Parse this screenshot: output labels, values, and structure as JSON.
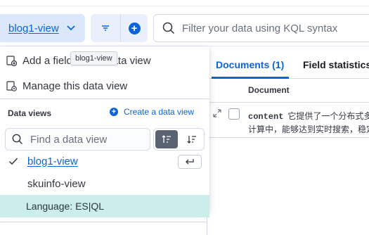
{
  "header": {
    "data_view_label": "blog1-view",
    "query_placeholder": "Filter your data using KQL syntax"
  },
  "tabs": {
    "documents": "Documents (1)",
    "field_statistics": "Field statistics"
  },
  "table": {
    "column_header": "Document",
    "rows": [
      {
        "key": "content",
        "line1": "它提供了一个分布式多",
        "line2": "计算中，能够达到实时搜索，稳定"
      }
    ]
  },
  "popover": {
    "menu_items": [
      {
        "label": "Add a field to this data view",
        "icon": "add-field-icon"
      },
      {
        "label": "Manage this data view",
        "icon": "manage-settings-icon"
      }
    ],
    "data_views_title": "Data views",
    "create_link_label": "Create a data view",
    "find_placeholder": "Find a data view",
    "items": [
      {
        "label": "blog1-view",
        "selected": true
      },
      {
        "label": "skuinfo-view",
        "selected": false
      }
    ],
    "language_label": "Language: ES|QL"
  },
  "tooltip": {
    "text": "blog1-view"
  },
  "colors": {
    "accent": "#0b64dd",
    "selected_bg": "#dbe7fb",
    "language_bg": "#cbeeea"
  }
}
